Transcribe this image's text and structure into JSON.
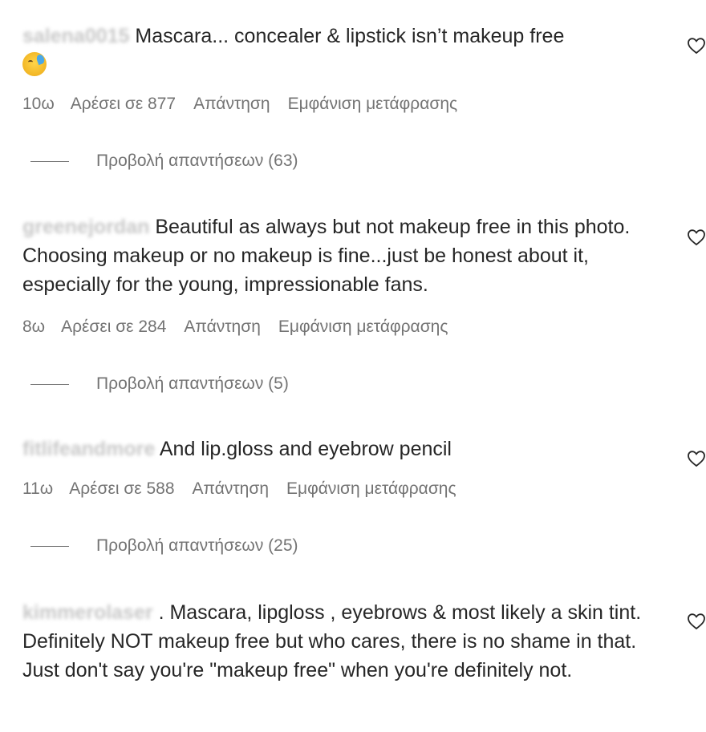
{
  "comments": [
    {
      "username": "salena0015",
      "text": "Mascara... concealer & lipstick isn’t makeup free",
      "emoji_icon": "sweat-smile-emoji",
      "time": "10ω",
      "likes": "Αρέσει σε 877",
      "reply": "Απάντηση",
      "translate": "Εμφάνιση μετάφρασης",
      "view_replies": "Προβολή απαντήσεων (63)"
    },
    {
      "username": "greenejordan",
      "text": "Beautiful as always but not makeup free in this photo. Choosing makeup or no makeup is fine...just be honest about it, especially for the young, impressionable fans.",
      "time": "8ω",
      "likes": "Αρέσει σε 284",
      "reply": "Απάντηση",
      "translate": "Εμφάνιση μετάφρασης",
      "view_replies": "Προβολή απαντήσεων (5)"
    },
    {
      "username": "fitlifeandmore",
      "text": "And lip.gloss and eyebrow pencil",
      "time": "11ω",
      "likes": "Αρέσει σε 588",
      "reply": "Απάντηση",
      "translate": "Εμφάνιση μετάφρασης",
      "view_replies": "Προβολή απαντήσεων (25)"
    },
    {
      "username": "kimmerolaser",
      "text": ". Mascara, lipgloss , eyebrows & most likely a skin tint. Definitely NOT makeup free but who cares, there is no shame in that. Just don't say you're \"makeup free\" when you're definitely not."
    }
  ],
  "icons": {
    "like": "heart-outline-icon"
  },
  "colors": {
    "text": "#262626",
    "meta": "#737373"
  }
}
